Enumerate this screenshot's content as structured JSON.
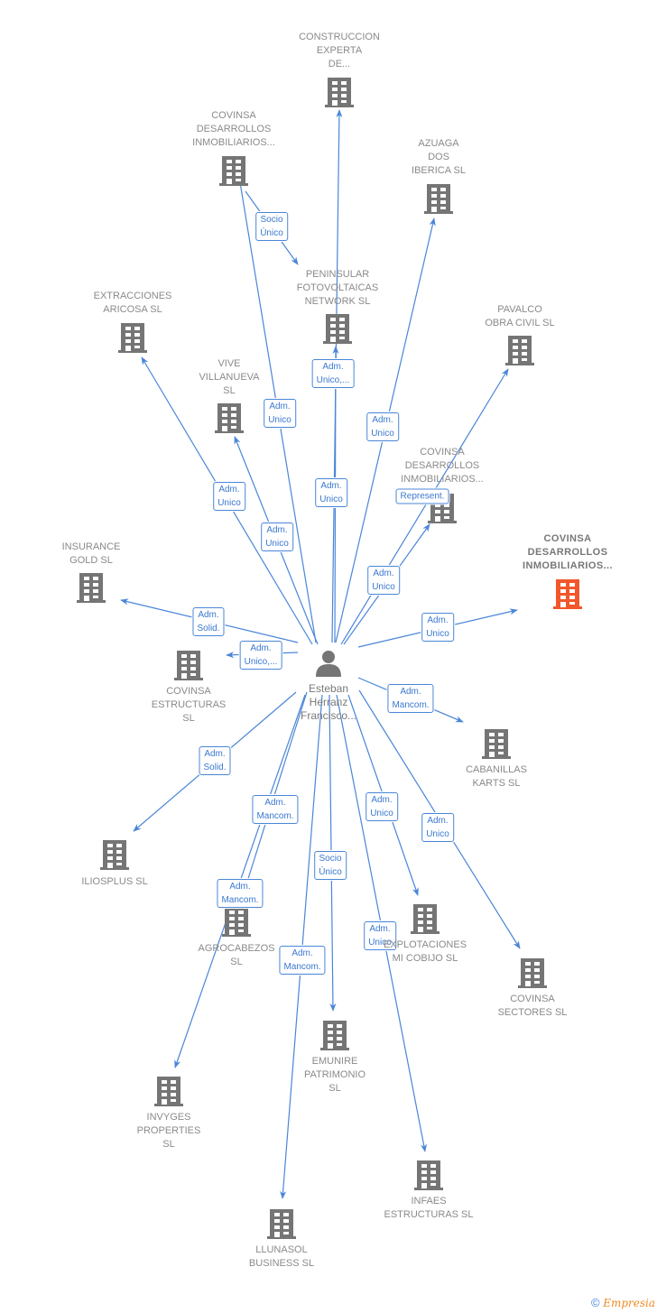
{
  "diagram": {
    "colors": {
      "edge": "#4a86d8",
      "company_icon": "#757575",
      "focus_company_icon": "#f2572b",
      "person_icon": "#757575",
      "label_text": "#8a8a8a",
      "edge_label_text": "#3b78d0"
    },
    "center": {
      "id": "person",
      "type": "person",
      "icon": "person-icon",
      "label_lines": [
        "Esteban",
        "Herranz",
        "Francisco..."
      ]
    },
    "nodes": [
      {
        "id": "construccion",
        "type": "company",
        "icon": "building-icon",
        "label_lines": [
          "CONSTRUCCION",
          "EXPERTA",
          "DE..."
        ]
      },
      {
        "id": "covinsa_des_top",
        "type": "company",
        "icon": "building-icon",
        "label_lines": [
          "COVINSA",
          "DESARROLLOS",
          "INMOBILIARIOS..."
        ]
      },
      {
        "id": "azuaga",
        "type": "company",
        "icon": "building-icon",
        "label_lines": [
          "AZUAGA",
          "DOS",
          "IBERICA  SL"
        ]
      },
      {
        "id": "peninsular",
        "type": "company",
        "icon": "building-icon",
        "label_lines": [
          "PENINSULAR",
          "FOTOVOLTAICAS",
          "NETWORK  SL"
        ]
      },
      {
        "id": "extracciones",
        "type": "company",
        "icon": "building-icon",
        "label_lines": [
          "EXTRACCIONES",
          "ARICOSA  SL"
        ]
      },
      {
        "id": "pavalco",
        "type": "company",
        "icon": "building-icon",
        "label_lines": [
          "PAVALCO",
          "OBRA CIVIL  SL"
        ]
      },
      {
        "id": "vive",
        "type": "company",
        "icon": "building-icon",
        "label_lines": [
          "VIVE",
          "VILLANUEVA",
          "SL"
        ]
      },
      {
        "id": "covinsa_des_mid",
        "type": "company",
        "icon": "building-icon",
        "label_lines": [
          "COVINSA",
          "DESARROLLOS",
          "INMOBILIARIOS..."
        ]
      },
      {
        "id": "covinsa_des_focus",
        "type": "company-focus",
        "icon": "building-icon",
        "label_lines": [
          "COVINSA",
          "DESARROLLOS",
          "INMOBILIARIOS..."
        ]
      },
      {
        "id": "insurance",
        "type": "company",
        "icon": "building-icon",
        "label_lines": [
          "INSURANCE",
          "GOLD  SL"
        ]
      },
      {
        "id": "covinsa_estr",
        "type": "company",
        "icon": "building-icon",
        "label_lines": [
          "COVINSA",
          "ESTRUCTURAS",
          "SL"
        ]
      },
      {
        "id": "cabanillas",
        "type": "company",
        "icon": "building-icon",
        "label_lines": [
          "CABANILLAS",
          "KARTS  SL"
        ]
      },
      {
        "id": "iliosplus",
        "type": "company",
        "icon": "building-icon",
        "label_lines": [
          "ILIOSPLUS  SL"
        ]
      },
      {
        "id": "agrocabezos",
        "type": "company",
        "icon": "building-icon",
        "label_lines": [
          "AGROCABEZOS",
          "SL"
        ]
      },
      {
        "id": "explotaciones",
        "type": "company",
        "icon": "building-icon",
        "label_lines": [
          "EXPLOTACIONES",
          "MI COBIJO  SL"
        ]
      },
      {
        "id": "covinsa_sect",
        "type": "company",
        "icon": "building-icon",
        "label_lines": [
          "COVINSA",
          "SECTORES  SL"
        ]
      },
      {
        "id": "emunire",
        "type": "company",
        "icon": "building-icon",
        "label_lines": [
          "EMUNIRE",
          "PATRIMONIO",
          "SL"
        ]
      },
      {
        "id": "invyges",
        "type": "company",
        "icon": "building-icon",
        "label_lines": [
          "INVYGES",
          "PROPERTIES",
          "SL"
        ]
      },
      {
        "id": "infaes",
        "type": "company",
        "icon": "building-icon",
        "label_lines": [
          "INFAES",
          "ESTRUCTURAS SL"
        ]
      },
      {
        "id": "llunasol",
        "type": "company",
        "icon": "building-icon",
        "label_lines": [
          "LLUNASOL",
          "BUSINESS  SL"
        ]
      }
    ],
    "edges": [
      {
        "from": "person",
        "to": "construccion",
        "label_lines": [
          "Adm.",
          "Unico"
        ]
      },
      {
        "from": "person",
        "to": "covinsa_des_top",
        "label_lines": [
          "Adm.",
          "Unico"
        ]
      },
      {
        "from": "covinsa_des_top",
        "to": "peninsular",
        "label_lines": [
          "Socio",
          "Único"
        ]
      },
      {
        "from": "person",
        "to": "azuaga",
        "label_lines": [
          "Adm.",
          "Unico"
        ]
      },
      {
        "from": "person",
        "to": "peninsular",
        "label_lines": [
          "Adm.",
          "Unico,..."
        ]
      },
      {
        "from": "person",
        "to": "extracciones",
        "label_lines": [
          "Adm.",
          "Unico"
        ]
      },
      {
        "from": "person",
        "to": "vive",
        "label_lines": [
          "Adm.",
          "Unico"
        ]
      },
      {
        "from": "person",
        "to": "pavalco",
        "label_lines": [
          "Represent."
        ]
      },
      {
        "from": "person",
        "to": "covinsa_des_mid",
        "label_lines": [
          "Adm.",
          "Unico"
        ]
      },
      {
        "from": "person",
        "to": "covinsa_des_focus",
        "label_lines": [
          "Adm.",
          "Unico"
        ]
      },
      {
        "from": "person",
        "to": "insurance",
        "label_lines": [
          "Adm.",
          "Solid."
        ]
      },
      {
        "from": "person",
        "to": "covinsa_estr",
        "label_lines": [
          "Adm.",
          "Unico,..."
        ]
      },
      {
        "from": "person",
        "to": "cabanillas",
        "label_lines": [
          "Adm.",
          "Mancom."
        ]
      },
      {
        "from": "person",
        "to": "iliosplus",
        "label_lines": [
          "Adm.",
          "Solid."
        ]
      },
      {
        "from": "person",
        "to": "agrocabezos",
        "label_lines": [
          "Adm.",
          "Mancom."
        ]
      },
      {
        "from": "person",
        "to": "invyges",
        "label_lines": [
          "Adm.",
          "Mancom."
        ]
      },
      {
        "from": "person",
        "to": "emunire",
        "label_lines": [
          "Socio",
          "Único"
        ]
      },
      {
        "from": "person",
        "to": "llunasol",
        "label_lines": [
          "Adm.",
          "Mancom."
        ]
      },
      {
        "from": "person",
        "to": "explotaciones",
        "label_lines": [
          "Adm.",
          "Unico"
        ]
      },
      {
        "from": "person",
        "to": "infaes",
        "label_lines": [
          "Adm.",
          "Unico"
        ]
      },
      {
        "from": "person",
        "to": "covinsa_sect",
        "label_lines": [
          "Adm.",
          "Unico"
        ]
      }
    ]
  },
  "footer": {
    "copyright_symbol": "©",
    "brand": "Empresia"
  }
}
